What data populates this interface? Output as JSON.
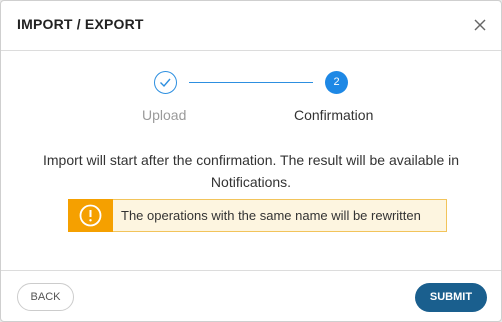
{
  "dialog": {
    "title": "IMPORT / EXPORT",
    "close_icon": "close-icon"
  },
  "stepper": {
    "steps": [
      {
        "label": "Upload",
        "state": "completed",
        "icon": "check-icon"
      },
      {
        "label": "Confirmation",
        "state": "active",
        "number": "2"
      }
    ]
  },
  "message": "Import will start after the confirmation. The result will be available in Notifications.",
  "warning": {
    "icon": "warning-icon",
    "text": "The operations with the same name will be rewritten"
  },
  "footer": {
    "back_label": "BACK",
    "submit_label": "SUBMIT"
  },
  "colors": {
    "accent": "#1e88e5",
    "submit": "#1a5f8e",
    "warning": "#f5a000",
    "warning_bg": "#fdf5e0"
  }
}
